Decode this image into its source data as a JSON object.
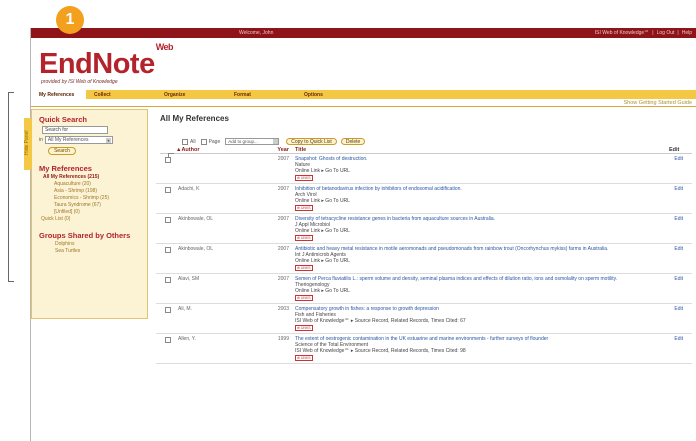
{
  "badge": "1",
  "topbar": {
    "welcome": "Welcome, John",
    "links": [
      "ISI Web of Knowledge℠",
      "|",
      "Log Out",
      "|",
      "Help"
    ]
  },
  "logo": {
    "name": "EndNote",
    "sup": "Web",
    "subtitle": "provided by ISI Web of Knowledge"
  },
  "tabs": [
    {
      "label": "My References",
      "active": true
    },
    {
      "label": "Collect",
      "active": false
    },
    {
      "label": "Organize",
      "active": false
    },
    {
      "label": "Format",
      "active": false
    },
    {
      "label": "Options",
      "active": false
    }
  ],
  "subbar_link": "Show Getting Started Guide",
  "sidebar": {
    "panel_tab": "Hide Panel",
    "quick_search_title": "Quick Search",
    "search_value": "Search for",
    "in_label": "in",
    "in_select": "All My References",
    "search_button": "Search",
    "my_refs_title": "My References",
    "all_refs": "All My References (215)",
    "groups": [
      "Aquaculture (20)",
      "Asia - Shrimp (198)",
      "Economics - Shrimp (25)",
      "Taura Syndrome (67)"
    ],
    "unfiled": "[Unfiled] (0)",
    "quick_list": "Quick List (0)",
    "shared_title": "Groups Shared by Others",
    "shared": [
      "Dolphins",
      "Sea Turtles"
    ]
  },
  "main": {
    "title": "All My References",
    "all_label": "All",
    "page_label": "Page",
    "add_group": "Add to group...",
    "copy_button": "Copy to Quick List",
    "delete_button": "Delete",
    "col_author": "▲Author",
    "col_year": "Year",
    "col_title": "Title",
    "col_edit": "Edit",
    "ulinks": "⊕ UNKS",
    "edit_label": "Edit"
  },
  "rows": [
    {
      "author": "",
      "year": "2007",
      "title": "Snapshot: Ghosts of destruction.",
      "journal": "Nature",
      "links": "Online Link ▸ Go To URL",
      "isi": false
    },
    {
      "author": "Adachi, K",
      "year": "2007",
      "title": "Inhibition of betanodavirus infection by inhibitors of endosomal acidification.",
      "journal": "Arch Virol",
      "links": "Online Link ▸ Go To URL",
      "isi": false
    },
    {
      "author": "Akinbowale, OL",
      "year": "2007",
      "title": "Diversity of tetracycline resistance genes in bacteria from aquaculture sources in Australia.",
      "journal": "J Appl Microbiol",
      "links": "Online Link ▸ Go To URL",
      "isi": false
    },
    {
      "author": "Akinbowale, OL",
      "year": "2007",
      "title": "Antibiotic and heavy metal resistance in motile aeromonads and pseudomonads from rainbow trout (Oncorhynchus mykiss) farms in Australia.",
      "journal": "Int J Antimicrob Agents",
      "links": "Online Link ▸ Go To URL",
      "isi": false
    },
    {
      "author": "Alavi, SM",
      "year": "2007",
      "title": "Semen of Perca fluviatilis L.: sperm volume and density, seminal plasma indices and effects of dilution ratio, ions and osmolality on sperm motility.",
      "journal": "Theriogenology",
      "links": "Online Link ▸ Go To URL",
      "isi": false
    },
    {
      "author": "Ali, M.",
      "year": "2003",
      "title": "Compensatory growth in fishes: a response to growth depression",
      "journal": "Fish and Fisheries",
      "links": "ISI Web of Knowledge℠ ▸ Source Record, Related Records, Times Cited: 67",
      "isi": true
    },
    {
      "author": "Allen, Y.",
      "year": "1999",
      "title": "The extent of oestrogenic contamination in the UK estuarine and marine environments - further surveys of flounder",
      "journal": "Science of the Total Environment",
      "links": "ISI Web of Knowledge℠ ▸ Source Record, Related Records, Times Cited: 98",
      "isi": true
    }
  ]
}
